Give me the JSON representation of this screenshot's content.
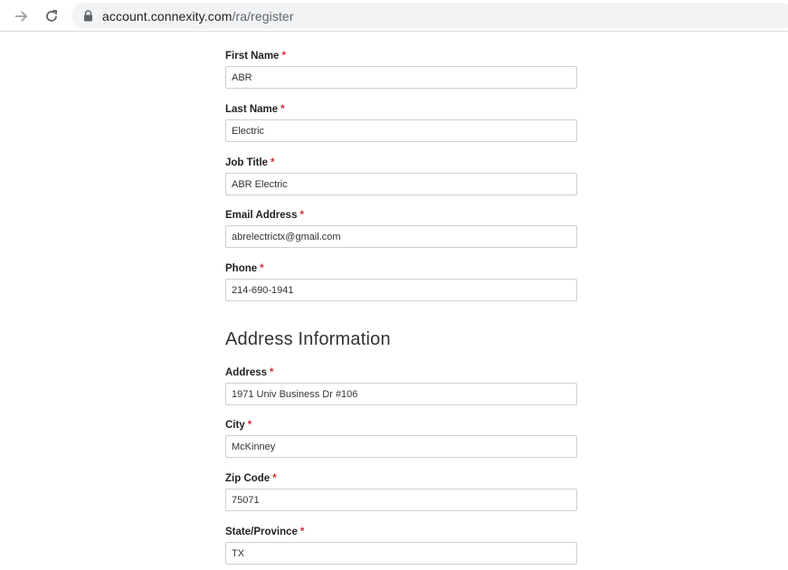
{
  "browser": {
    "url_host": "account.connexity.com",
    "url_path": "/ra/register",
    "icons": [
      "forward-arrow-icon",
      "reload-icon",
      "lock-icon"
    ]
  },
  "form": {
    "required_marker": "*",
    "fields": [
      {
        "label": "First Name",
        "value": "ABR"
      },
      {
        "label": "Last Name",
        "value": "Electric"
      },
      {
        "label": "Job Title",
        "value": "ABR Electric"
      },
      {
        "label": "Email Address",
        "value": "abrelectrictx@gmail.com"
      },
      {
        "label": "Phone",
        "value": "214-690-1941"
      }
    ],
    "address_section_title": "Address Information",
    "address_fields": [
      {
        "label": "Address",
        "value": "1971 Univ Business Dr #106"
      },
      {
        "label": "City",
        "value": "McKinney"
      },
      {
        "label": "Zip Code",
        "value": "75071"
      },
      {
        "label": "State/Province",
        "value": "TX"
      }
    ]
  },
  "colors": {
    "required": "#d7282f",
    "omnibox_bg": "#f1f3f4",
    "input_border": "#cfcfcf"
  }
}
